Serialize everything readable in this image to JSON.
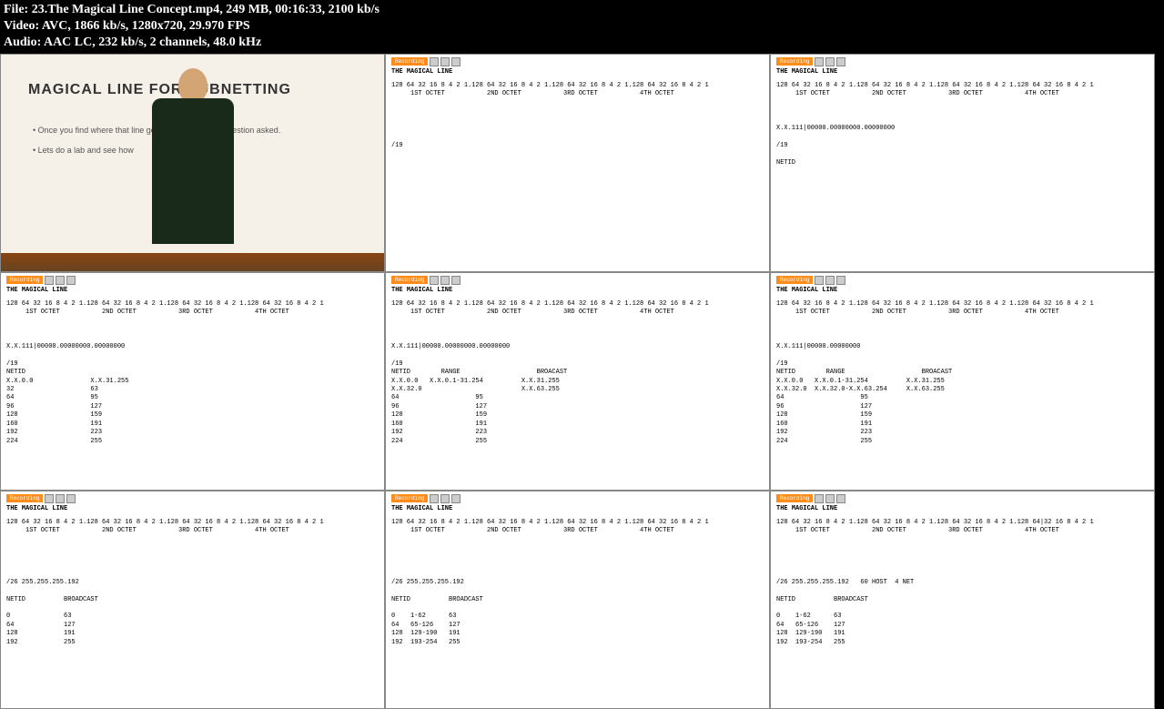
{
  "header": {
    "file": "File: 23.The Magical Line Concept.mp4, 249 MB, 00:16:33, 2100 kb/s",
    "video": "Video: AVC, 1866 kb/s, 1280x720, 29.970 FPS",
    "audio": "Audio: AAC LC, 232 kb/s, 2 channels, 48.0 kHz"
  },
  "classroom": {
    "title": "MAGICAL LINE FOR            SUBNETTING",
    "bullet1": "• Once you find where that line go               any IPv4 address question asked.",
    "bullet2": "• Lets do a lab and see how"
  },
  "npbar": {
    "rec": "Recording"
  },
  "f2": {
    "title": "THE MAGICAL LINE",
    "body": "128 64 32 16 8 4 2 1.128 64 32 16 8 4 2 1.128 64 32 16 8 4 2 1.128 64 32 16 8 4 2 1\n     1ST OCTET           2ND OCTET           3RD OCTET           4TH OCTET\n\n\n\n\n\n/19"
  },
  "f3": {
    "title": "THE MAGICAL LINE",
    "body": "128 64 32 16 8 4 2 1.128 64 32 16 8 4 2 1.128 64 32 16 8 4 2 1.128 64 32 16 8 4 2 1\n     1ST OCTET           2ND OCTET           3RD OCTET           4TH OCTET\n\n\n\nX.X.111|00000.00000000.00000000\n\n/19\n\nNETID"
  },
  "f4": {
    "title": "THE MAGICAL LINE",
    "body": "128 64 32 16 8 4 2 1.128 64 32 16 8 4 2 1.128 64 32 16 8 4 2 1.128 64 32 16 8 4 2 1\n     1ST OCTET           2ND OCTET           3RD OCTET           4TH OCTET\n\n\n\nX.X.111|00000.00000000.00000000\n\n/19\nNETID\nX.X.0.0               X.X.31.255\n32                    63\n64                    95\n96                    127\n128                   159\n160                   191\n192                   223\n224                   255"
  },
  "f5": {
    "title": "THE MAGICAL LINE",
    "body": "128 64 32 16 8 4 2 1.128 64 32 16 8 4 2 1.128 64 32 16 8 4 2 1.128 64 32 16 8 4 2 1\n     1ST OCTET           2ND OCTET           3RD OCTET           4TH OCTET\n\n\n\nX.X.111|00000.00000000.00000000\n\n/19\nNETID        RANGE                    BROACAST\nX.X.0.0   X.X.0.1-31.254          X.X.31.255\nX.X.32.0                          X.X.63.255\n64                    95\n96                    127\n128                   159\n160                   191\n192                   223\n224                   255"
  },
  "f6": {
    "title": "THE MAGICAL LINE",
    "body": "128 64 32 16 8 4 2 1.128 64 32 16 8 4 2 1.128 64 32 16 8 4 2 1.128 64 32 16 8 4 2 1\n     1ST OCTET           2ND OCTET           3RD OCTET           4TH OCTET\n\n\n\nX.X.111|00000.00000000\n\n/19\nNETID        RANGE                    BROACAST\nX.X.0.0   X.X.0.1-31.254          X.X.31.255\nX.X.32.0  X.X.32.0-X.X.63.254     X.X.63.255\n64                    95\n96                    127\n128                   159\n160                   191\n192                   223\n224                   255"
  },
  "f7": {
    "title": "THE MAGICAL LINE",
    "body": "128 64 32 16 8 4 2 1.128 64 32 16 8 4 2 1.128 64 32 16 8 4 2 1.128 64 32 16 8 4 2 1\n     1ST OCTET           2ND OCTET           3RD OCTET           4TH OCTET\n\n\n\n\n\n/26 255.255.255.192\n\nNETID          BROADCAST\n\n0              63\n64             127\n128            191\n192            255"
  },
  "f8": {
    "title": "THE MAGICAL LINE",
    "body": "128 64 32 16 8 4 2 1.128 64 32 16 8 4 2 1.128 64 32 16 8 4 2 1.128 64 32 16 8 4 2 1\n     1ST OCTET           2ND OCTET           3RD OCTET           4TH OCTET\n\n\n\n\n\n/26 255.255.255.192\n\nNETID          BROADCAST\n\n0    1-62      63\n64   65-126    127\n128  129-190   191\n192  193-254   255"
  },
  "f9": {
    "title": "THE MAGICAL LINE",
    "body": "128 64 32 16 8 4 2 1.128 64 32 16 8 4 2 1.128 64 32 16 8 4 2 1.128 64|32 16 8 4 2 1\n     1ST OCTET           2ND OCTET           3RD OCTET           4TH OCTET\n\n\n\n\n\n/26 255.255.255.192   60 HOST  4 NET\n\nNETID          BROADCAST\n\n0    1-62      63\n64   65-126    127\n128  129-190   191\n192  193-254   255"
  }
}
